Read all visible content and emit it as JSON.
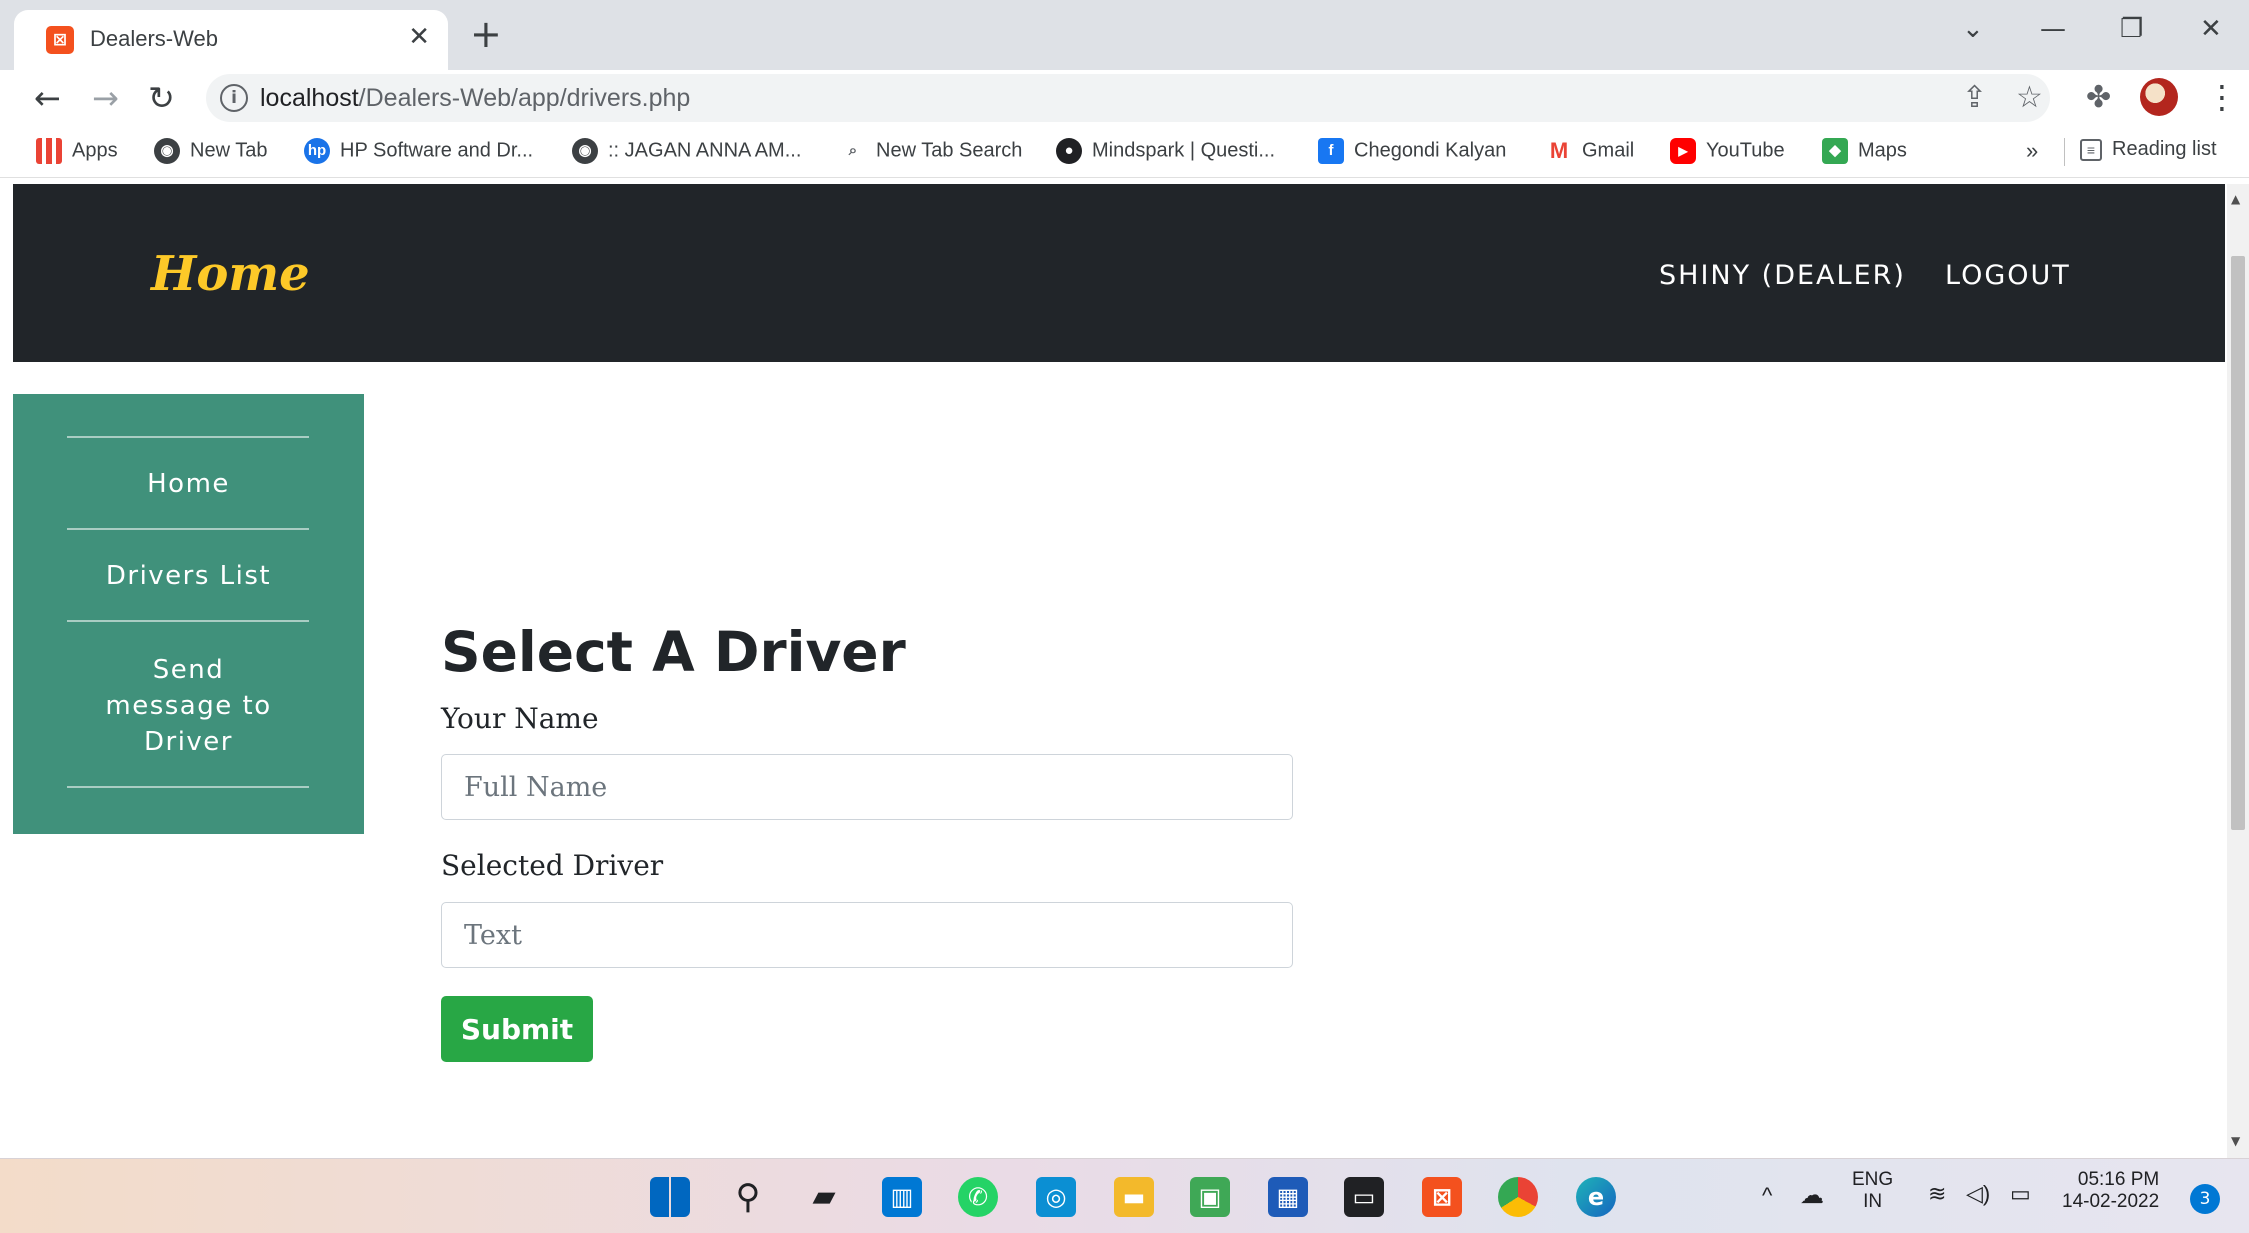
{
  "browser": {
    "tab_title": "Dealers-Web",
    "tab_close": "✕",
    "new_tab": "+",
    "url_host": "localhost",
    "url_path": "/Dealers-Web/app/drivers.php",
    "bookmarks": [
      {
        "label": "Apps",
        "icon": "apps-grid-icon"
      },
      {
        "label": "New Tab",
        "icon": "globe-icon"
      },
      {
        "label": "HP Software and Dr...",
        "icon": "hp-icon"
      },
      {
        "label": ":: JAGAN ANNA AM...",
        "icon": "globe-icon"
      },
      {
        "label": "New Tab Search",
        "icon": "search-icon"
      },
      {
        "label": "Mindspark | Questi...",
        "icon": "mindspark-icon"
      },
      {
        "label": "Chegondi Kalyan",
        "icon": "facebook-icon"
      },
      {
        "label": "Gmail",
        "icon": "gmail-icon"
      },
      {
        "label": "YouTube",
        "icon": "youtube-icon"
      },
      {
        "label": "Maps",
        "icon": "maps-icon"
      }
    ],
    "more_bookmarks": "»",
    "reading_list": "Reading list"
  },
  "navbar": {
    "brand": "Home",
    "user": "SHINY (DEALER)",
    "logout": "LOGOUT",
    "bg_color": "#212529",
    "brand_color": "#fdc928"
  },
  "sidebar": {
    "items": [
      "Home",
      "Drivers List",
      "Send message to Driver"
    ],
    "bg_color": "#40917b"
  },
  "form": {
    "title": "Select A Driver",
    "name_label": "Your Name",
    "name_placeholder": "Full Name",
    "driver_label": "Selected Driver",
    "driver_placeholder": "Text",
    "submit": "Submit",
    "submit_color": "#28a745"
  },
  "taskbar": {
    "language_top": "ENG",
    "language_bottom": "IN",
    "time": "05:16 PM",
    "date": "14-02-2022",
    "notifications": "3"
  }
}
